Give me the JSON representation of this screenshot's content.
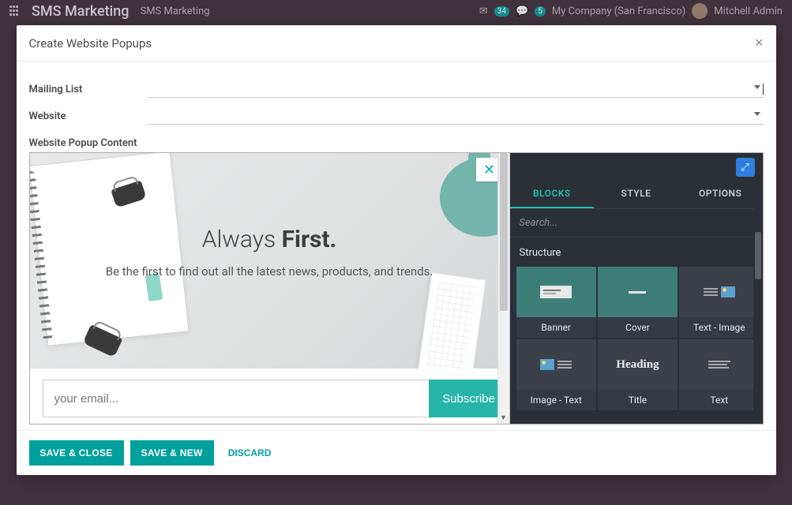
{
  "topbar": {
    "title": "SMS Marketing",
    "breadcrumb": "SMS Marketing",
    "company": "My Company (San Francisco)",
    "user": "Mitchell Admin",
    "counter1": "34",
    "counter2": "5"
  },
  "modal": {
    "title": "Create Website Popups",
    "close_aria": "Close"
  },
  "form": {
    "mailing_list_label": "Mailing List",
    "website_label": "Website",
    "content_label": "Website Popup Content"
  },
  "preview": {
    "title_light": "Always ",
    "title_bold": "First.",
    "subtitle": "Be the first to find out all the latest news, products, and trends.",
    "email_placeholder": "your email...",
    "subscribe": "Subscribe"
  },
  "sidebar": {
    "tabs": {
      "blocks": "BLOCKS",
      "style": "STYLE",
      "options": "OPTIONS"
    },
    "search_placeholder": "Search...",
    "section": "Structure",
    "blocks": {
      "banner": "Banner",
      "cover": "Cover",
      "textimage": "Text - Image",
      "imagetext": "Image - Text",
      "title": "Title",
      "text": "Text",
      "heading_thumb": "Heading"
    }
  },
  "footer": {
    "save_close": "SAVE & CLOSE",
    "save_new": "SAVE & NEW",
    "discard": "DISCARD"
  }
}
